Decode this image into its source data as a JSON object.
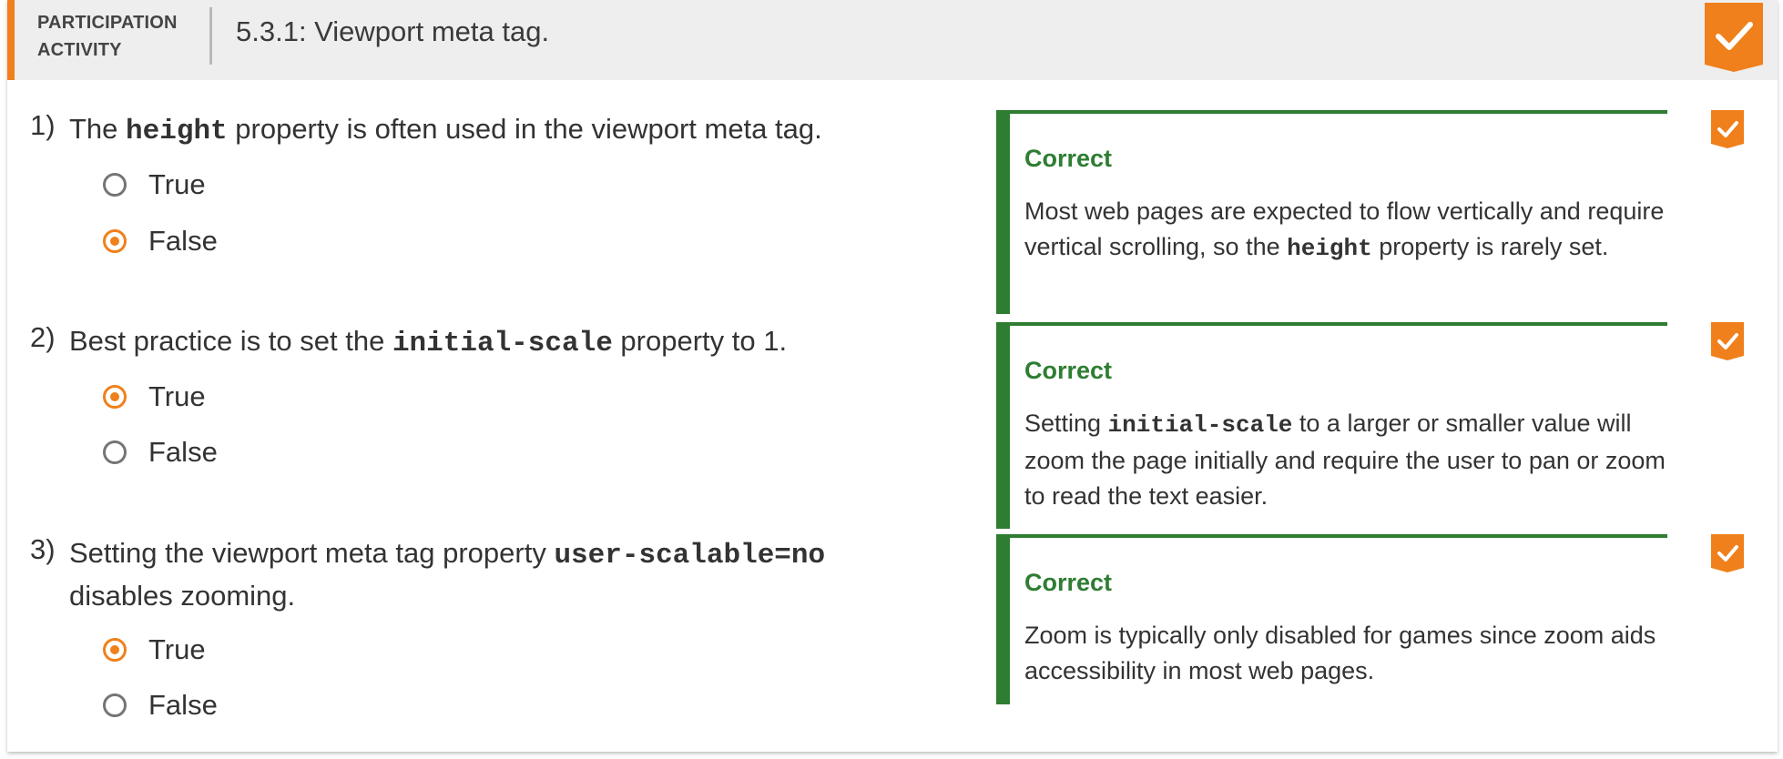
{
  "header": {
    "participation_label_line1": "PARTICIPATION",
    "participation_label_line2": "ACTIVITY",
    "title": "5.3.1: Viewport meta tag.",
    "completion_icon": "checkmark-badge-icon"
  },
  "colors": {
    "accent": "#f0801b",
    "correct_green": "#2e7d32",
    "header_bg": "#eeeeee"
  },
  "questions": [
    {
      "number": "1)",
      "text_before": "The ",
      "code": "height",
      "text_after": " property is often used in the viewport meta tag.",
      "options": [
        "True",
        "False"
      ],
      "selected": "False",
      "feedback": {
        "heading": "Correct",
        "text_before": "Most web pages are expected to flow vertically and require vertical scrolling, so the ",
        "code": "height",
        "text_after": " property is rarely set."
      },
      "status_icon": "check-icon"
    },
    {
      "number": "2)",
      "text_before": "Best practice is to set the ",
      "code": "initial-scale",
      "text_after": " property to 1.",
      "options": [
        "True",
        "False"
      ],
      "selected": "True",
      "feedback": {
        "heading": "Correct",
        "text_before": "Setting ",
        "code": "initial-scale",
        "text_after": " to a larger or smaller value will zoom the page initially and require the user to pan or zoom to read the text easier."
      },
      "status_icon": "check-icon"
    },
    {
      "number": "3)",
      "text_before": "Setting the viewport meta tag property ",
      "code": "user-scalable=no",
      "text_after": " disables zooming.",
      "options": [
        "True",
        "False"
      ],
      "selected": "True",
      "feedback": {
        "heading": "Correct",
        "text_before": "Zoom is typically only disabled for games since zoom aids accessibility in most web pages.",
        "code": "",
        "text_after": ""
      },
      "status_icon": "check-icon"
    }
  ]
}
